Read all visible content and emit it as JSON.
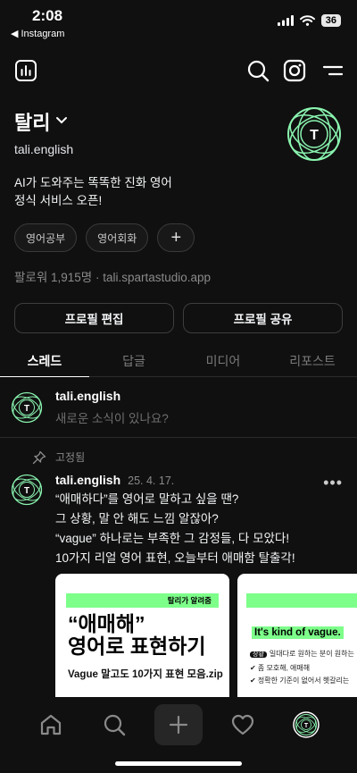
{
  "status": {
    "time": "2:08",
    "back_app": "Instagram",
    "battery": "36"
  },
  "profile": {
    "name": "탈리",
    "handle": "tali.english",
    "bio_line1": "AI가 도와주는 똑똑한 진화 영어",
    "bio_line2": "정식 서비스 오픈!",
    "avatar_letter": "T",
    "chips": [
      "영어공부",
      "영어회화"
    ],
    "followers": "팔로워 1,915명 · tali.spartastudio.app"
  },
  "buttons": {
    "edit": "프로필 편집",
    "share": "프로필 공유"
  },
  "tabs": [
    "스레드",
    "답글",
    "미디어",
    "리포스트"
  ],
  "compose": {
    "name": "tali.english",
    "placeholder": "새로운 소식이 있나요?"
  },
  "post": {
    "pinned_label": "고정됨",
    "author": "tali.english",
    "date": "25. 4. 17.",
    "more": "•••",
    "lines": [
      "“애매하다”를 영어로 말하고 싶을 땐?",
      "그 상황, 말 안 해도 느낌 알잖아?",
      "“vague” 하나로는 부족한 그 감정들, 다 모았다!",
      "10가지 리얼 영어 표현, 오늘부터 애매함 탈출각!"
    ],
    "card1": {
      "tag": "탈리가 알려줌",
      "title_line1": "“애매해”",
      "title_line2": "영어로 표현하기",
      "subtitle": "Vague 말고도 10가지 표현 모음.zip"
    },
    "card2": {
      "title": "It's kind of vague.",
      "row1_pill": "상황",
      "row1_text": "일대다로 원하는 분이 원하는",
      "row2": "✔ 좀 모호해, 애매해",
      "row3": "✔ 정확한 기준이 없어서 헷갈리는"
    }
  },
  "colors": {
    "background": "#101010",
    "accent_green": "#7dff8a",
    "logo_green": "#8af5b0"
  }
}
